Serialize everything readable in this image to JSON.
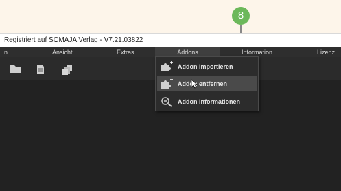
{
  "window": {
    "title": "Registriert auf SOMAJA Verlag - V7.21.03822"
  },
  "menu": {
    "items": [
      {
        "label": "n"
      },
      {
        "label": "Ansicht"
      },
      {
        "label": "Extras"
      },
      {
        "label": "Addons"
      },
      {
        "label": "Information"
      },
      {
        "label": "Lizenz"
      }
    ]
  },
  "toolbar": {
    "icons": [
      "folder-icon",
      "document-icon",
      "copy-icon"
    ]
  },
  "addons_menu": {
    "items": [
      {
        "label": "Addon importieren",
        "icon": "puzzle-add-icon"
      },
      {
        "label": "Addon entfernen",
        "icon": "puzzle-remove-icon"
      },
      {
        "label": "Addon Informationen",
        "icon": "addon-info-icon"
      }
    ]
  },
  "annotation": {
    "step": "8",
    "color": "#6cb85a"
  }
}
